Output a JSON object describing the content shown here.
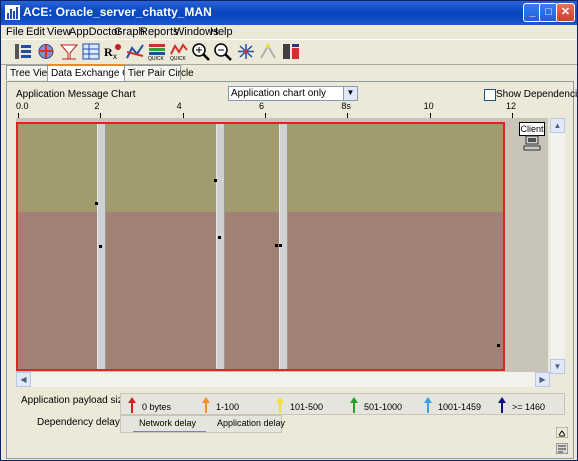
{
  "window": {
    "title": "ACE: Oracle_server_chatty_MAN"
  },
  "menu": [
    "File",
    "Edit",
    "View",
    "AppDoctor",
    "Graph",
    "Reports",
    "Windows",
    "Help"
  ],
  "toolbar_icons": [
    "tree-view-icon",
    "globe-icon",
    "funnel-icon",
    "table-icon",
    "rx-icon",
    "chart-icon",
    "quick-icon-1",
    "quick-icon-2",
    "zoom-in-icon",
    "zoom-out-icon",
    "network-icon",
    "sparkle-icon",
    "compare-icon",
    "filter-icon"
  ],
  "tabs": [
    {
      "label": "Tree View",
      "active": false
    },
    {
      "label": "Data Exchange Chart",
      "active": true
    },
    {
      "label": "Tier Pair Circle",
      "active": false
    }
  ],
  "chart": {
    "label": "Application Message Chart",
    "view_select": "Application chart only",
    "show_dependencies_label": "Show Dependencies",
    "show_dependencies_checked": false,
    "ruler_ticks": [
      "0.0",
      "2",
      "4",
      "6",
      "8s",
      "10",
      "12"
    ],
    "tier_label": "Client"
  },
  "chart_data": {
    "type": "timeline",
    "xunit": "s",
    "xlim": [
      0,
      12
    ],
    "gaps": [
      [
        1.95,
        2.15
      ],
      [
        4.9,
        5.1
      ],
      [
        6.45,
        6.65
      ]
    ],
    "messages": [
      {
        "t": 1.9
      },
      {
        "t": 2.0
      },
      {
        "t": 4.85
      },
      {
        "t": 4.95
      },
      {
        "t": 6.35
      },
      {
        "t": 6.45
      },
      {
        "t": 11.85
      }
    ]
  },
  "legend": {
    "payload_label": "Application payload size:",
    "dependency_label": "Dependency delays:",
    "items": [
      {
        "label": "0 bytes",
        "color": "#d62222"
      },
      {
        "label": "1-100",
        "color": "#f0902a"
      },
      {
        "label": "101-500",
        "color": "#f0e030"
      },
      {
        "label": "501-1000",
        "color": "#28a028"
      },
      {
        "label": "1001-1459",
        "color": "#3aa0f0"
      },
      {
        "label": ">= 1460",
        "color": "#10108a"
      }
    ],
    "delays": [
      "Network delay",
      "Application delay"
    ]
  }
}
